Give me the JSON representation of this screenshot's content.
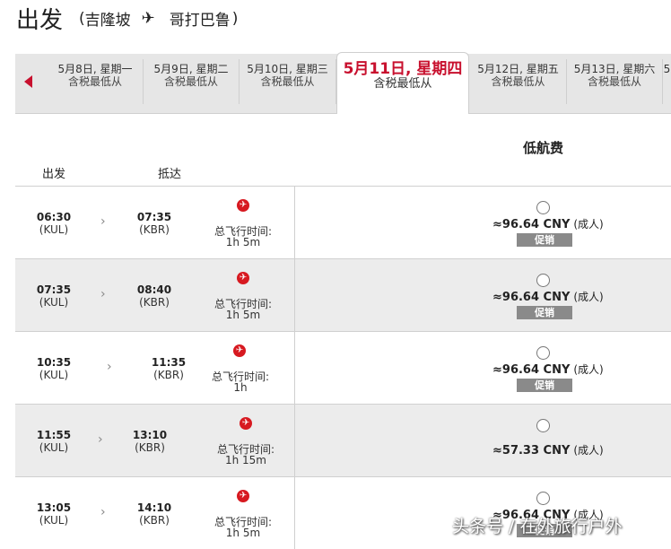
{
  "header": {
    "title": "出发",
    "route_open": "(",
    "origin": "吉隆坡",
    "destination": "哥打巴鲁",
    "route_close": ")"
  },
  "date_tabs": [
    {
      "date": "5月8日, 星期一",
      "sub": "含税最低从"
    },
    {
      "date": "5月9日, 星期二",
      "sub": "含税最低从"
    },
    {
      "date": "5月10日, 星期三",
      "sub": "含税最低从"
    },
    {
      "date": "5月11日, 星期四",
      "sub": "含税最低从",
      "active": true
    },
    {
      "date": "5月12日, 星期五",
      "sub": "含税最低从"
    },
    {
      "date": "5月13日, 星期六",
      "sub": "含税最低从"
    },
    {
      "date": "5",
      "sub": ""
    }
  ],
  "columns": {
    "depart": "出发",
    "arrive": "抵达",
    "fare_class": "低航费"
  },
  "duration_label": "总飞行时间:",
  "flights": [
    {
      "dep_time": "06:30",
      "dep_code": "(KUL)",
      "arr_time": "07:35",
      "arr_code": "(KBR)",
      "duration": "1h 5m",
      "price": "≈96.64 CNY",
      "pax": "(成人)",
      "promo": "促销"
    },
    {
      "dep_time": "07:35",
      "dep_code": "(KUL)",
      "arr_time": "08:40",
      "arr_code": "(KBR)",
      "duration": "1h 5m",
      "price": "≈96.64 CNY",
      "pax": "(成人)",
      "promo": "促销"
    },
    {
      "dep_time": "10:35",
      "dep_code": "(KUL)",
      "arr_time": "11:35",
      "arr_code": "(KBR)",
      "duration": "1h",
      "price": "≈96.64 CNY",
      "pax": "(成人)",
      "promo": "促销"
    },
    {
      "dep_time": "11:55",
      "dep_code": "(KUL)",
      "arr_time": "13:10",
      "arr_code": "(KBR)",
      "duration": "1h 15m",
      "price": "≈57.33 CNY",
      "pax": "(成人)",
      "promo": ""
    },
    {
      "dep_time": "13:05",
      "dep_code": "(KUL)",
      "arr_time": "14:10",
      "arr_code": "(KBR)",
      "duration": "1h 5m",
      "price": "≈96.64 CNY",
      "pax": "(成人)",
      "promo": "促销"
    }
  ],
  "watermark": "头条号 / 在外旅行户外",
  "colors": {
    "accent": "#c8102e",
    "promo_bg": "#8a8a8a",
    "tab_bg": "#e6e6e6"
  }
}
